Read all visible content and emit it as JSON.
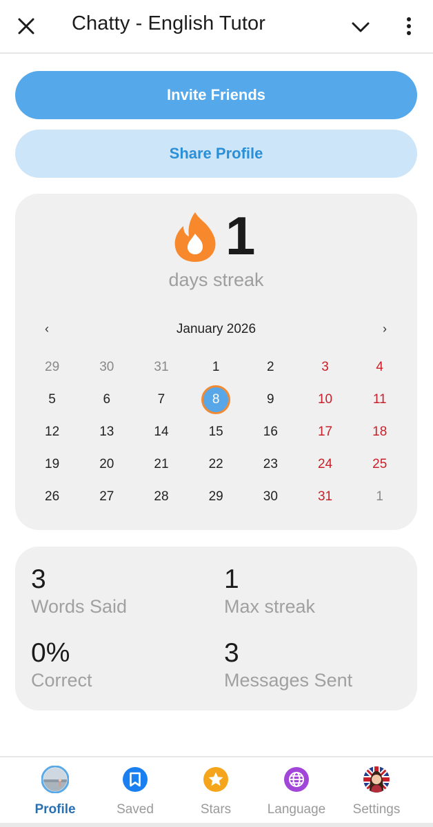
{
  "header": {
    "title": "Chatty - English Tutor"
  },
  "actions": {
    "invite_label": "Invite Friends",
    "share_label": "Share Profile"
  },
  "streak": {
    "value": "1",
    "label": "days streak"
  },
  "calendar": {
    "prev": "‹",
    "next": "›",
    "month": "January 2026",
    "selected": "8",
    "rows": [
      [
        "29",
        "30",
        "31",
        "1",
        "2",
        "3",
        "4"
      ],
      [
        "5",
        "6",
        "7",
        "8",
        "9",
        "10",
        "11"
      ],
      [
        "12",
        "13",
        "14",
        "15",
        "16",
        "17",
        "18"
      ],
      [
        "19",
        "20",
        "21",
        "22",
        "23",
        "24",
        "25"
      ],
      [
        "26",
        "27",
        "28",
        "29",
        "30",
        "31",
        "1"
      ]
    ]
  },
  "stats": {
    "words_said": {
      "value": "3",
      "label": "Words Said"
    },
    "max_streak": {
      "value": "1",
      "label": "Max streak"
    },
    "correct": {
      "value": "0%",
      "label": "Correct"
    },
    "messages_sent": {
      "value": "3",
      "label": "Messages Sent"
    }
  },
  "nav": {
    "items": [
      {
        "label": "Profile",
        "icon": "profile-avatar-icon"
      },
      {
        "label": "Saved",
        "icon": "bookmark-icon"
      },
      {
        "label": "Stars",
        "icon": "star-icon"
      },
      {
        "label": "Language",
        "icon": "globe-icon"
      },
      {
        "label": "Settings",
        "icon": "settings-avatar-icon"
      }
    ]
  },
  "colors": {
    "primary": "#55a8e9",
    "primary_light": "#cde5f9",
    "flame": "#f7882b",
    "weekend": "#c8202a",
    "card_bg": "#f0f0f0"
  }
}
